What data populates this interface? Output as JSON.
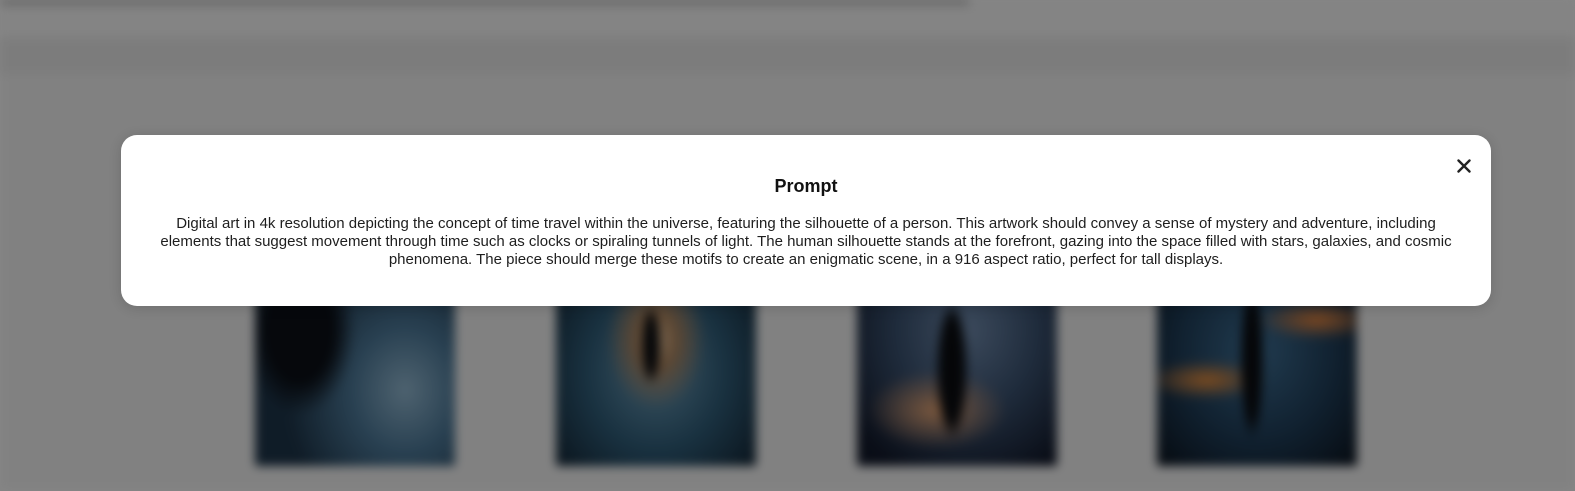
{
  "modal": {
    "title": "Prompt",
    "close_icon": "close-icon",
    "text": "Digital art in 4k resolution depicting the concept of time travel within the universe, featuring the silhouette of a person. This artwork should convey a sense of mystery and adventure, including elements that suggest movement through time such as clocks or spiraling tunnels of light. The human silhouette stands at the forefront, gazing into the space filled with stars, galaxies, and cosmic phenomena. The piece should merge these motifs to create an enigmatic scene, in a 916 aspect ratio, perfect for tall displays."
  },
  "overlay_color": "#000000",
  "modal_background": "#ffffff"
}
